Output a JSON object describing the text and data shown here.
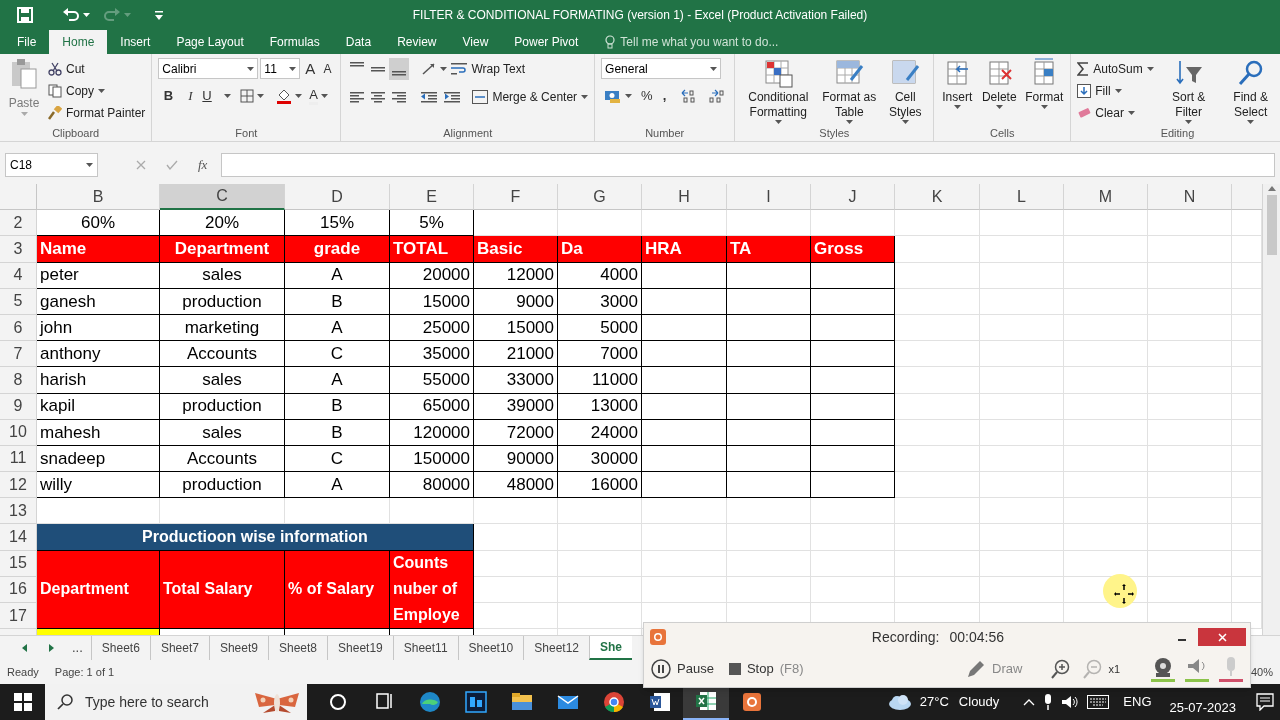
{
  "title_bar": {
    "title": "FILTER & CONDITIONAL FORMATING (version 1) - Excel (Product Activation Failed)",
    "redo_disabled": true
  },
  "ribbon_tabs": [
    {
      "label": "File",
      "selected": false
    },
    {
      "label": "Home",
      "selected": true
    },
    {
      "label": "Insert",
      "selected": false
    },
    {
      "label": "Page Layout",
      "selected": false
    },
    {
      "label": "Formulas",
      "selected": false
    },
    {
      "label": "Data",
      "selected": false
    },
    {
      "label": "Review",
      "selected": false
    },
    {
      "label": "View",
      "selected": false
    },
    {
      "label": "Power Pivot",
      "selected": false
    }
  ],
  "tell_me": {
    "placeholder": "Tell me what you want to do..."
  },
  "ribbon": {
    "clipboard": {
      "label": "Clipboard",
      "paste": "Paste",
      "paste_disabled": true,
      "cut": "Cut",
      "copy": "Copy",
      "format_painter": "Format Painter"
    },
    "font": {
      "label": "Font",
      "font_name": "Calibri",
      "font_size": "11",
      "grow": "A",
      "shrink": "A",
      "bold": "B",
      "italic": "I",
      "underline": "U",
      "font_color": "A"
    },
    "alignment": {
      "label": "Alignment",
      "wrap_text": "Wrap Text",
      "merge_center": "Merge & Center"
    },
    "number": {
      "label": "Number",
      "format": "General",
      "percent": "%",
      "comma": ","
    },
    "styles": {
      "label": "Styles",
      "conditional": "Conditional Formatting",
      "format_table": "Format as Table",
      "cell_styles": "Cell Styles"
    },
    "cells": {
      "label": "Cells",
      "insert": "Insert",
      "delete": "Delete",
      "format": "Format"
    },
    "editing": {
      "label": "Editing",
      "autosum": "AutoSum",
      "fill": "Fill",
      "clear": "Clear",
      "sort_filter": "Sort & Filter",
      "find_select": "Find & Select"
    }
  },
  "formula_bar": {
    "name_box": "C18",
    "fx": "fx"
  },
  "sheet": {
    "columns": [
      {
        "label": "B",
        "selected": false
      },
      {
        "label": "C",
        "selected": true
      },
      {
        "label": "D",
        "selected": false
      },
      {
        "label": "E",
        "selected": false
      },
      {
        "label": "F",
        "selected": false
      },
      {
        "label": "G",
        "selected": false
      },
      {
        "label": "H",
        "selected": false
      },
      {
        "label": "I",
        "selected": false
      },
      {
        "label": "J",
        "selected": false
      },
      {
        "label": "K",
        "selected": false
      },
      {
        "label": "L",
        "selected": false
      },
      {
        "label": "M",
        "selected": false
      },
      {
        "label": "N",
        "selected": false
      }
    ],
    "rows": [
      {
        "number": "2",
        "kind": "percent",
        "cells": [
          "60%",
          "20%",
          "15%",
          "5%"
        ]
      },
      {
        "number": "3",
        "kind": "header",
        "cells": [
          "Name",
          "Department",
          "grade",
          "TOTAL",
          "Basic",
          "Da",
          "HRA",
          "TA",
          "Gross"
        ]
      },
      {
        "number": "4",
        "kind": "data",
        "cells": [
          "peter",
          "sales",
          "A",
          "20000",
          "12000",
          "4000"
        ]
      },
      {
        "number": "5",
        "kind": "data",
        "cells": [
          "ganesh",
          "production",
          "B",
          "15000",
          "9000",
          "3000"
        ]
      },
      {
        "number": "6",
        "kind": "data",
        "cells": [
          "john",
          "marketing",
          "A",
          "25000",
          "15000",
          "5000"
        ]
      },
      {
        "number": "7",
        "kind": "data",
        "cells": [
          "anthony",
          "Accounts",
          "C",
          "35000",
          "21000",
          "7000"
        ]
      },
      {
        "number": "8",
        "kind": "data",
        "cells": [
          "harish",
          "sales",
          "A",
          "55000",
          "33000",
          "11000"
        ]
      },
      {
        "number": "9",
        "kind": "data",
        "cells": [
          "kapil",
          "production",
          "B",
          "65000",
          "39000",
          "13000"
        ]
      },
      {
        "number": "10",
        "kind": "data",
        "cells": [
          "mahesh",
          "sales",
          "B",
          "120000",
          "72000",
          "24000"
        ]
      },
      {
        "number": "11",
        "kind": "data",
        "cells": [
          "snadeep",
          "Accounts",
          "C",
          "150000",
          "90000",
          "30000"
        ]
      },
      {
        "number": "12",
        "kind": "data",
        "cells": [
          "willy",
          "production",
          "A",
          "80000",
          "48000",
          "16000"
        ]
      },
      {
        "number": "13",
        "kind": "blank"
      },
      {
        "number": "14",
        "kind": "section_title",
        "cells": [
          "Productioon wise information"
        ]
      },
      {
        "number": "15",
        "kind": "section_header",
        "cells": [
          "Department",
          "Total Salary",
          "% of Salary",
          "Counts nuber of Employe"
        ]
      },
      {
        "number": "16",
        "kind": "continued"
      },
      {
        "number": "17",
        "kind": "continued"
      },
      {
        "kind": "partial"
      }
    ]
  },
  "sheet_tabs": {
    "more": "...",
    "tabs": [
      {
        "label": "Sheet6",
        "selected": false
      },
      {
        "label": "Sheet7",
        "selected": false
      },
      {
        "label": "Sheet9",
        "selected": false
      },
      {
        "label": "Sheet8",
        "selected": false
      },
      {
        "label": "Sheet19",
        "selected": false
      },
      {
        "label": "Sheet11",
        "selected": false
      },
      {
        "label": "Sheet10",
        "selected": false
      },
      {
        "label": "Sheet12",
        "selected": false
      },
      {
        "label": "She",
        "selected": true
      }
    ]
  },
  "status_bar": {
    "mode": "Ready",
    "page": "Page: 1 of 1",
    "zoom": "40%"
  },
  "recorder": {
    "label": "Recording:",
    "time": "00:04:56",
    "pause": "Pause",
    "stop": "Stop",
    "stop_key": "(F8)",
    "draw": "Draw",
    "zoom_factor": "x1"
  },
  "taskbar": {
    "search_placeholder": "Type here to search",
    "temperature": "27°C",
    "weather": "Cloudy",
    "language": "ENG",
    "date": "25-07-2023"
  }
}
